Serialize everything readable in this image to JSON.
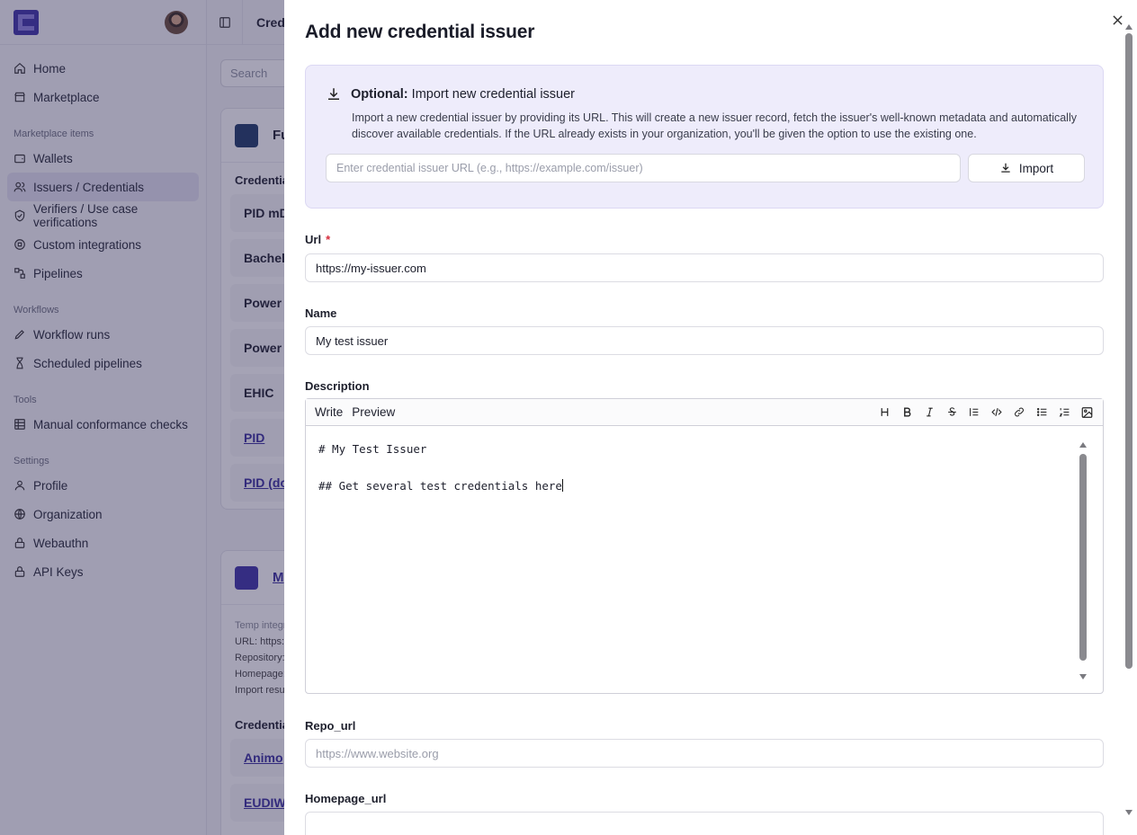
{
  "sidebar": {
    "items_main": [
      {
        "label": "Home",
        "icon": "home-icon"
      },
      {
        "label": "Marketplace",
        "icon": "store-icon"
      }
    ],
    "section_marketplace": "Marketplace items",
    "items_marketplace": [
      {
        "label": "Wallets",
        "icon": "wallet-icon"
      },
      {
        "label": "Issuers / Credentials",
        "icon": "users-icon",
        "active": true
      },
      {
        "label": "Verifiers / Use case verifications",
        "icon": "shield-check-icon"
      },
      {
        "label": "Custom integrations",
        "icon": "puzzle-icon"
      },
      {
        "label": "Pipelines",
        "icon": "workflow-icon"
      }
    ],
    "section_workflows": "Workflows",
    "items_workflows": [
      {
        "label": "Workflow runs",
        "icon": "pencil-icon"
      },
      {
        "label": "Scheduled pipelines",
        "icon": "hourglass-icon"
      }
    ],
    "section_tools": "Tools",
    "items_tools": [
      {
        "label": "Manual conformance checks",
        "icon": "table-icon"
      }
    ],
    "section_settings": "Settings",
    "items_settings": [
      {
        "label": "Profile",
        "icon": "user-icon"
      },
      {
        "label": "Organization",
        "icon": "globe-icon"
      },
      {
        "label": "Webauthn",
        "icon": "lock-icon"
      },
      {
        "label": "API Keys",
        "icon": "lock-icon"
      }
    ]
  },
  "background": {
    "breadcrumb": "Cred",
    "search_placeholder": "Search",
    "card1": {
      "title": "Fu",
      "credentials_label": "Credentia",
      "rows": [
        "PID mD",
        "Bachel",
        "Power",
        "Power",
        "EHIC",
        "PID",
        "PID (do"
      ]
    },
    "card2": {
      "title": "M",
      "lines": [
        "Temp integr",
        "URL: https:/",
        "Repository:",
        "Homepage:",
        "Import resu"
      ],
      "credentials_label": "Credentia",
      "rows": [
        "Animo",
        "EUDIW"
      ]
    }
  },
  "modal": {
    "title": "Add new credential issuer",
    "import": {
      "heading_bold": "Optional:",
      "heading_rest": " Import new credential issuer",
      "description": "Import a new credential issuer by providing its URL. This will create a new issuer record, fetch the issuer's well-known metadata and automatically discover available credentials. If the URL already exists in your organization, you'll be given the option to use the existing one.",
      "placeholder": "Enter credential issuer URL (e.g., https://example.com/issuer)",
      "button": "Import"
    },
    "url": {
      "label": "Url",
      "required_mark": "*",
      "value": "https://my-issuer.com"
    },
    "name": {
      "label": "Name",
      "value": "My test issuer"
    },
    "description": {
      "label": "Description",
      "tab_write": "Write",
      "tab_preview": "Preview",
      "tools": [
        "heading-icon",
        "bold-icon",
        "italic-icon",
        "strikethrough-icon",
        "quote-icon",
        "code-icon",
        "link-icon",
        "bullet-list-icon",
        "numbered-list-icon",
        "image-icon"
      ],
      "line1": "# My Test Issuer",
      "line2": "",
      "line3": "## Get several test credentials here"
    },
    "repo_url": {
      "label": "Repo_url",
      "placeholder": "https://www.website.org"
    },
    "homepage_url": {
      "label": "Homepage_url"
    }
  },
  "colors": {
    "accent": "#3f35a8",
    "overlay": "#28244e",
    "import_bg": "#eeecfb",
    "required": "#d62b3a"
  }
}
